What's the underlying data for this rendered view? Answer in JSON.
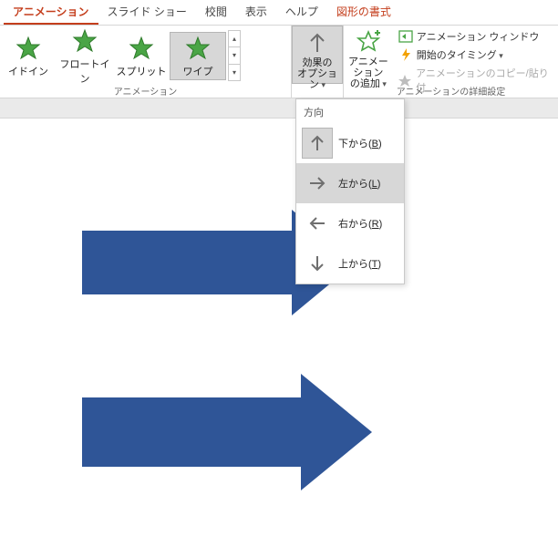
{
  "tabs": [
    {
      "label": "アニメーション",
      "active": true
    },
    {
      "label": "スライド ショー"
    },
    {
      "label": "校閲"
    },
    {
      "label": "表示"
    },
    {
      "label": "ヘルプ"
    },
    {
      "label": "図形の書式",
      "contextual": true
    }
  ],
  "ribbon": {
    "animation_group": {
      "label": "アニメーション",
      "items": [
        {
          "label": "イドイン"
        },
        {
          "label": "フロートイン"
        },
        {
          "label": "スプリット"
        },
        {
          "label": "ワイプ",
          "selected": true
        }
      ]
    },
    "effect_options": {
      "line1": "効果の",
      "line2": "オプション"
    },
    "add_animation": {
      "line1": "アニメーション",
      "line2": "の追加"
    },
    "advanced_group": {
      "label": "アニメーションの詳細設定",
      "pane": "アニメーション ウィンドウ",
      "trigger": "開始のタイミング",
      "copy": "アニメーションのコピー/貼り付"
    }
  },
  "dropdown": {
    "header": "方向",
    "items": [
      {
        "label": "下から(",
        "accel": "B",
        "suffix": ")",
        "selected": true,
        "dir": "up"
      },
      {
        "label": "左から(",
        "accel": "L",
        "suffix": ")",
        "hover": true,
        "dir": "right"
      },
      {
        "label": "右から(",
        "accel": "R",
        "suffix": ")",
        "dir": "left"
      },
      {
        "label": "上から(",
        "accel": "T",
        "suffix": ")",
        "dir": "down"
      }
    ]
  }
}
